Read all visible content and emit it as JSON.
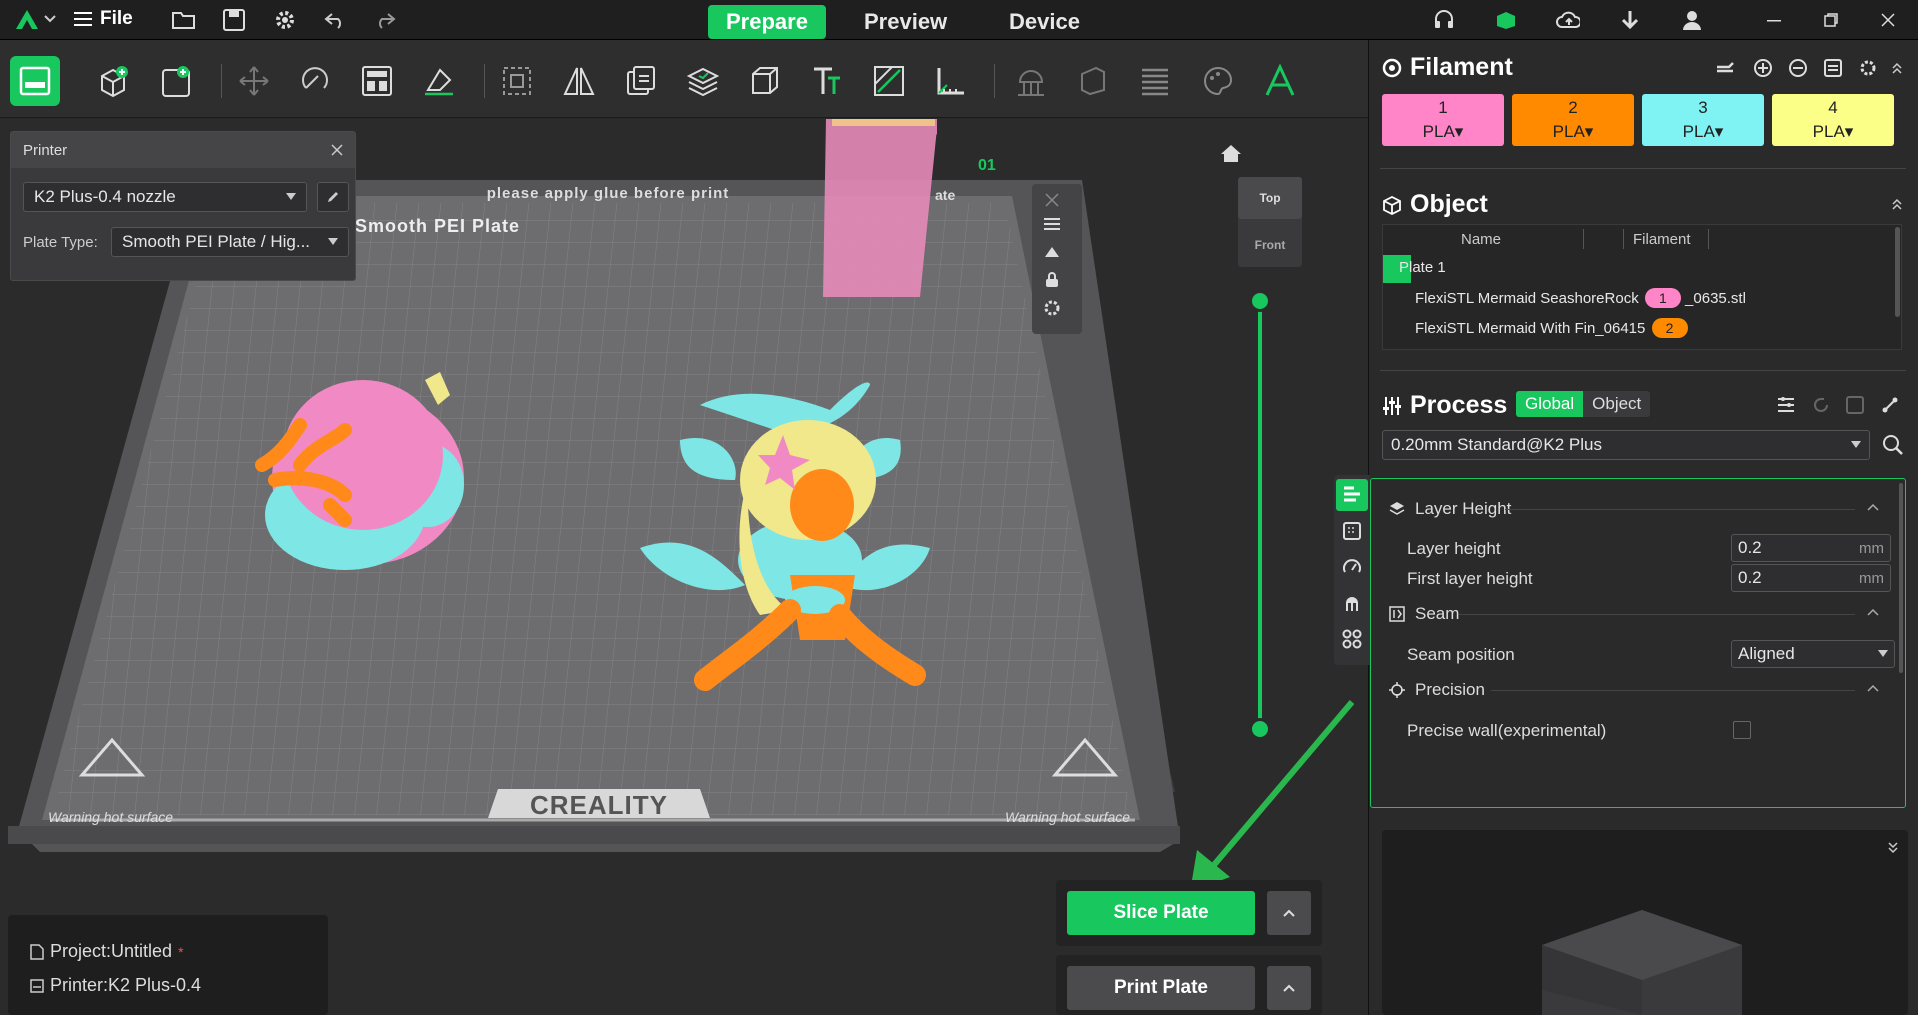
{
  "titlebar": {
    "file_label": "File",
    "tabs": [
      "Prepare",
      "Preview",
      "Device"
    ],
    "active_tab": "Prepare"
  },
  "printer_panel": {
    "title": "Printer",
    "printer": "K2 Plus-0.4 nozzle",
    "plate_type_label": "Plate Type:",
    "plate_type": "Smooth PEI Plate / Hig..."
  },
  "bed": {
    "top_text": "please apply glue before print",
    "top_right_text": "ate",
    "plate_name": "Smooth PEI Plate",
    "plate_number": "01",
    "brand": "CREALITY",
    "warning_left": "Warning hot surface",
    "warning_right": "Warning hot surface"
  },
  "view_cube": {
    "top": "Top",
    "front": "Front"
  },
  "status": {
    "project_label": "Project:Untitled",
    "project_modified": "*",
    "printer_label": "Printer:K2 Plus-0.4"
  },
  "actions": {
    "slice": "Slice Plate",
    "print": "Print Plate"
  },
  "filament": {
    "title": "Filament",
    "slots": [
      {
        "num": "1",
        "type": "PLA",
        "color": "#ff85c8"
      },
      {
        "num": "2",
        "type": "PLA",
        "color": "#ff8a00"
      },
      {
        "num": "3",
        "type": "PLA",
        "color": "#7ff3f3"
      },
      {
        "num": "4",
        "type": "PLA",
        "color": "#fcff87"
      }
    ]
  },
  "object": {
    "title": "Object",
    "columns": [
      "Name",
      "Filament"
    ],
    "plate": "Plate 1",
    "rows": [
      {
        "name": "FlexiSTL Mermaid SeashoreRock",
        "filament": "1",
        "suffix": "_0635",
        "ext": ".stl"
      },
      {
        "name": "FlexiSTL Mermaid With Fin_06415",
        "filament": "2"
      }
    ]
  },
  "process": {
    "title": "Process",
    "tabs": [
      "Global",
      "Object"
    ],
    "preset": "0.20mm Standard@K2 Plus",
    "groups": {
      "layer_height": {
        "title": "Layer Height",
        "layer_height_label": "Layer height",
        "layer_height": "0.2",
        "first_layer_label": "First layer height",
        "first_layer": "0.2",
        "unit": "mm"
      },
      "seam": {
        "title": "Seam",
        "position_label": "Seam position",
        "position": "Aligned"
      },
      "precision": {
        "title": "Precision",
        "precise_wall_label": "Precise wall(experimental)"
      }
    }
  },
  "colors": {
    "accent": "#18c75e",
    "model_cyan": "#7fe6e6",
    "model_pink": "#f085c8",
    "model_orange": "#ff8a1a",
    "model_yellow": "#f0e88a"
  }
}
